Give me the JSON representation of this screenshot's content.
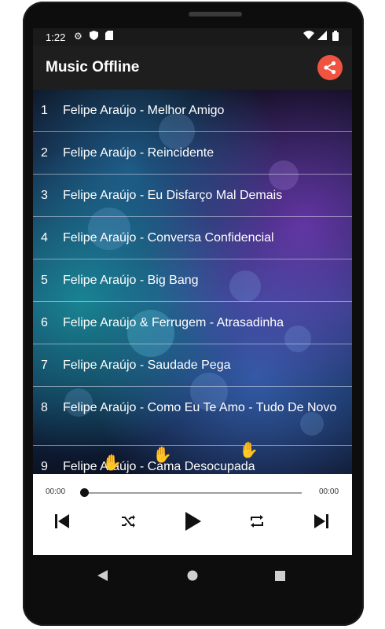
{
  "status": {
    "time": "1:22"
  },
  "app": {
    "title": "Music Offline"
  },
  "songs": [
    {
      "num": "1",
      "title": "Felipe Araújo - Melhor Amigo"
    },
    {
      "num": "2",
      "title": "Felipe Araújo - Reincidente"
    },
    {
      "num": "3",
      "title": "Felipe Araújo - Eu Disfarço Mal Demais"
    },
    {
      "num": "4",
      "title": "Felipe Araújo - Conversa Confidencial"
    },
    {
      "num": "5",
      "title": "Felipe Araújo - Big Bang"
    },
    {
      "num": "6",
      "title": "Felipe Araújo & Ferrugem - Atrasadinha"
    },
    {
      "num": "7",
      "title": "Felipe Araújo - Saudade Pega"
    },
    {
      "num": "8",
      "title": "Felipe Araújo - Como Eu Te Amo - Tudo De Novo"
    },
    {
      "num": "9",
      "title": "Felipe Araújo - Cama Desocupada"
    }
  ],
  "player": {
    "current_time": "00:00",
    "total_time": "00:00",
    "progress": 0
  },
  "icons": {
    "settings": "gear-icon",
    "shield": "shield-icon",
    "sd": "sd-card-icon",
    "wifi": "wifi-icon",
    "signal": "signal-icon",
    "battery": "battery-icon",
    "share": "share-icon",
    "prev": "skip-previous-icon",
    "shuffle": "shuffle-icon",
    "play": "play-icon",
    "repeat": "repeat-icon",
    "next": "skip-next-icon",
    "back": "back-icon",
    "home": "home-icon",
    "recents": "recents-icon"
  },
  "colors": {
    "accent": "#f0533f",
    "appbar": "#1e1e1e",
    "statusbar": "#1a1a1a",
    "player_bg": "#ffffff"
  }
}
